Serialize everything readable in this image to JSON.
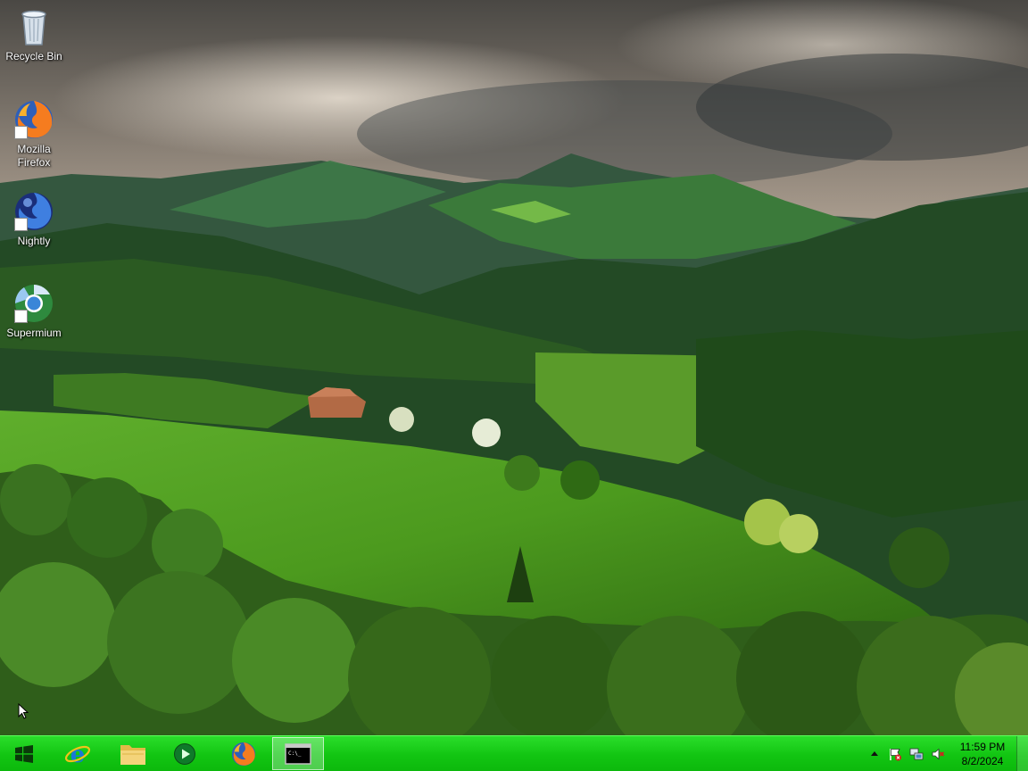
{
  "desktop": {
    "icons": [
      {
        "label": "Recycle Bin",
        "icon": "recycle-bin-icon"
      },
      {
        "label": "Mozilla Firefox",
        "icon": "firefox-icon"
      },
      {
        "label": "Nightly",
        "icon": "nightly-icon"
      },
      {
        "label": "Supermium",
        "icon": "supermium-icon"
      }
    ]
  },
  "taskbar": {
    "color": "#12c512",
    "items": [
      {
        "name": "start",
        "icon": "windows-logo-icon"
      },
      {
        "name": "internet-explorer",
        "icon": "internet-explorer-icon"
      },
      {
        "name": "file-explorer",
        "icon": "folder-icon"
      },
      {
        "name": "media-player",
        "icon": "media-player-icon"
      },
      {
        "name": "firefox",
        "icon": "firefox-icon"
      },
      {
        "name": "command-prompt",
        "icon": "command-prompt-icon",
        "active": true
      }
    ],
    "tray": {
      "icons": [
        "show-hidden-icons-chevron",
        "action-center-flag-icon",
        "network-icon",
        "volume-muted-icon"
      ],
      "time": "11:59 PM",
      "date": "8/2/2024"
    }
  }
}
